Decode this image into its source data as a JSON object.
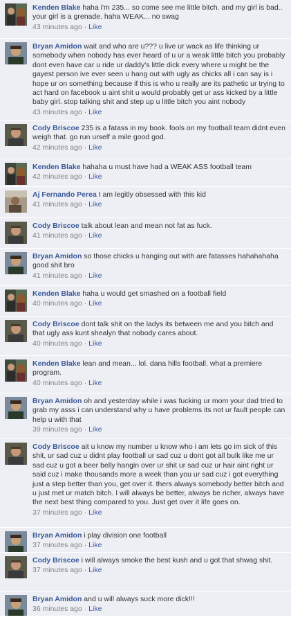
{
  "colors": {
    "link": "#3b5998",
    "background": "#edeff4",
    "text": "#333333",
    "meta": "#808080"
  },
  "separator": "·",
  "comments": [
    {
      "author": "Kenden Blake",
      "avatar": "avatar-kenden",
      "text": "haha i'm 235... so come see me little bitch. and my girl is bad.. your girl is a grenade. haha WEAK... no swag",
      "time": "43 minutes ago",
      "like": "Like"
    },
    {
      "author": "Bryan Amidon",
      "avatar": "avatar-bryan",
      "text": "wait and who are u??? u live ur wack as life thinking ur somebody when nobody has ever heard of u ur a weak little bitch you probably dont even have car u ride ur daddy's little dick every where u might be the gayest person ive ever seen u hang out with ugly as chicks all i can say is i hope ur on something because if this is who u really are its pathetic ur trying to act hard on facebook u aint shit u would probably get ur ass kicked by a little baby girl. stop talking shit and step up u little bitch you aint nobody",
      "time": "43 minutes ago",
      "like": "Like"
    },
    {
      "author": "Cody Briscoe",
      "avatar": "avatar-cody",
      "text": "235 is a fatass in my book. fools on my football team didnt even weigh that. go run urself a mile good god.",
      "time": "42 minutes ago",
      "like": "Like"
    },
    {
      "author": "Kenden Blake",
      "avatar": "avatar-kenden",
      "text": "hahaha u must have had a WEAK ASS football team",
      "time": "42 minutes ago",
      "like": "Like"
    },
    {
      "author": "Aj Fernando Perea",
      "avatar": "avatar-aj",
      "text": "I am legitly obsessed with this kid",
      "time": "41 minutes ago",
      "like": "Like"
    },
    {
      "author": "Cody Briscoe",
      "avatar": "avatar-cody",
      "text": "talk about lean and mean not fat as fuck.",
      "time": "41 minutes ago",
      "like": "Like"
    },
    {
      "author": "Bryan Amidon",
      "avatar": "avatar-bryan",
      "text": "so those chicks u hanging out with are fatasses hahahahaha good shit bro",
      "time": "41 minutes ago",
      "like": "Like"
    },
    {
      "author": "Kenden Blake",
      "avatar": "avatar-kenden",
      "text": "haha u would get smashed on a football field",
      "time": "40 minutes ago",
      "like": "Like"
    },
    {
      "author": "Cody Briscoe",
      "avatar": "avatar-cody",
      "text": "dont talk shit on the ladys its between me and you bitch and that ugly ass kunt shealyn that nobody cares about.",
      "time": "40 minutes ago",
      "like": "Like"
    },
    {
      "author": "Kenden Blake",
      "avatar": "avatar-kenden",
      "text": "lean and mean... lol. dana hills football. what a premiere program.",
      "time": "40 minutes ago",
      "like": "Like"
    },
    {
      "author": "Bryan Amidon",
      "avatar": "avatar-bryan",
      "text": "oh and yesterday while i was fucking ur mom your dad tried to grab my asss i can understand why u have problems its not ur fault people can help u with that",
      "time": "39 minutes ago",
      "like": "Like"
    },
    {
      "author": "Cody Briscoe",
      "avatar": "avatar-cody",
      "text": "ait u know my number u know who i am lets go im sick of this shit, ur sad cuz u didnt play football ur sad cuz u dont got all bulk like me ur sad cuz u got a beer belly hangin over ur shit ur sad cuz ur hair aint right ur said cuz i make thousands more a week than you ur sad cuz i got everything just a step better than you, get over it. thers always somebody better bitch and u just met ur match bitch. I will always be better, always be richer, always have the next best thing compared to you. Just get over it life goes on.",
      "time": "37 minutes ago",
      "like": "Like"
    },
    {
      "author": "Bryan Amidon",
      "avatar": "avatar-bryan",
      "text": "i play division one football",
      "time": "37 minutes ago",
      "like": "Like"
    },
    {
      "author": "Cody Briscoe",
      "avatar": "avatar-cody",
      "text": "i will always smoke the best kush and u got that shwag shit.",
      "time": "37 minutes ago",
      "like": "Like"
    },
    {
      "author": "Bryan Amidon",
      "avatar": "avatar-bryan",
      "text": "and u will always suck more dick!!!",
      "time": "36 minutes ago",
      "like": "Like"
    }
  ]
}
